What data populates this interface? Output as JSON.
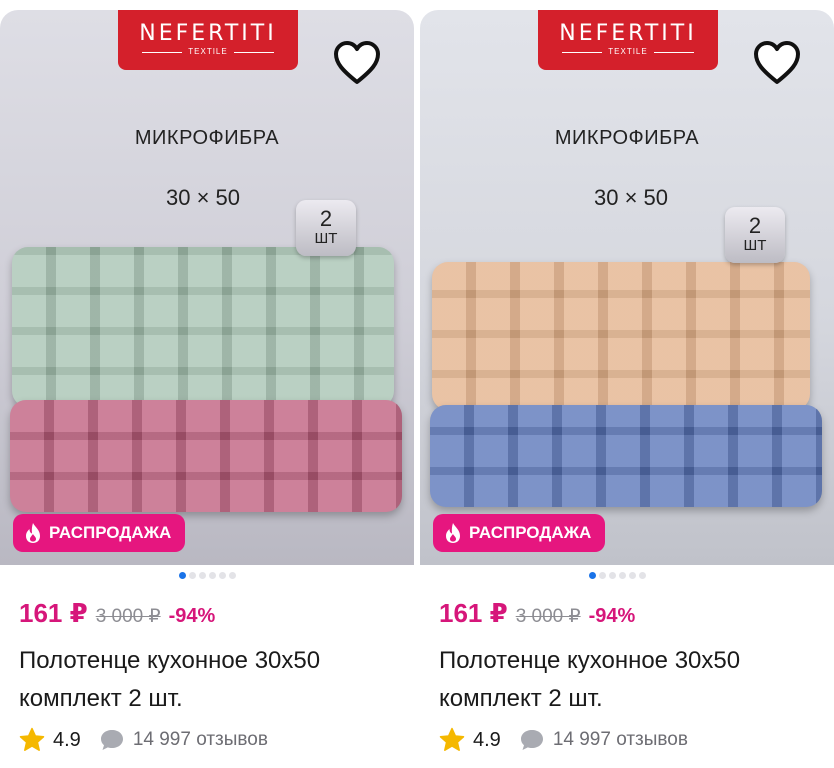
{
  "products": [
    {
      "brand": "NEFERTITI",
      "brand_sub": "TEXTILE",
      "material": "МИКРОФИБРА",
      "size": "30 × 50",
      "count_num": "2",
      "count_unit": "ШТ",
      "sale_label": "РАСПРОДАЖА",
      "price": "161 ₽",
      "old_price": "3 000 ₽",
      "discount": "-94%",
      "title": "Полотенце кухонное 30х50 комплект 2 шт.",
      "rating": "4.9",
      "reviews": "14 997 отзывов",
      "towel_colors": [
        "#a8c4b3",
        "#c0607f"
      ]
    },
    {
      "brand": "NEFERTITI",
      "brand_sub": "TEXTILE",
      "material": "МИКРОФИБРА",
      "size": "30 × 50",
      "count_num": "2",
      "count_unit": "ШТ",
      "sale_label": "РАСПРОДАЖА",
      "price": "161 ₽",
      "old_price": "3 000 ₽",
      "discount": "-94%",
      "title": "Полотенце кухонное 30х50 комплект 2 шт.",
      "rating": "4.9",
      "reviews": "14 997 отзывов",
      "towel_colors": [
        "#e3b18a",
        "#5a76ba"
      ]
    }
  ],
  "colors": {
    "accent": "#e6167f",
    "brand_red": "#d4202b",
    "active_dot": "#1a73e8",
    "star": "#f5b800"
  },
  "icons": [
    "heart-icon",
    "fire-icon",
    "star-icon",
    "chat-icon"
  ]
}
